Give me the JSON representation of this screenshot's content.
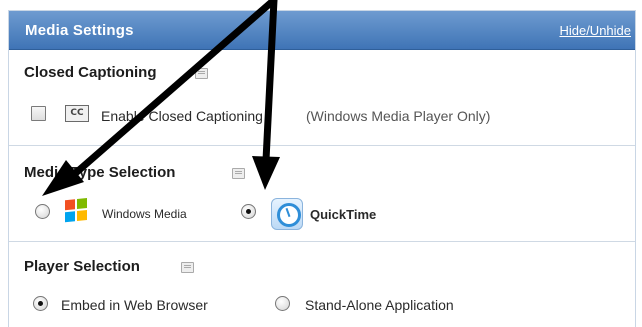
{
  "panel": {
    "title": "Media Settings",
    "hide_unhide_label": "Hide/Unhide"
  },
  "closed_captioning": {
    "heading": "Closed Captioning",
    "checkbox_label": "Enable Closed Captioning",
    "note": "(Windows Media Player Only)",
    "cc_icon_text": "CC"
  },
  "media_type": {
    "heading": "Media Type Selection",
    "options": [
      {
        "label": "Windows Media",
        "icon": "windows-logo-icon",
        "selected": false
      },
      {
        "label": "QuickTime",
        "icon": "quicktime-logo-icon",
        "selected": true
      }
    ]
  },
  "player": {
    "heading": "Player Selection",
    "options": [
      {
        "label": "Embed in Web Browser",
        "selected": true
      },
      {
        "label": "Stand-Alone Application",
        "selected": false
      }
    ]
  },
  "colors": {
    "header_top": "#6e9bd0",
    "header_bottom": "#3f74b6",
    "annotation_arrow": "#000000",
    "windows_logo": [
      "#f25022",
      "#7fba00",
      "#00a4ef",
      "#ffb900"
    ]
  }
}
